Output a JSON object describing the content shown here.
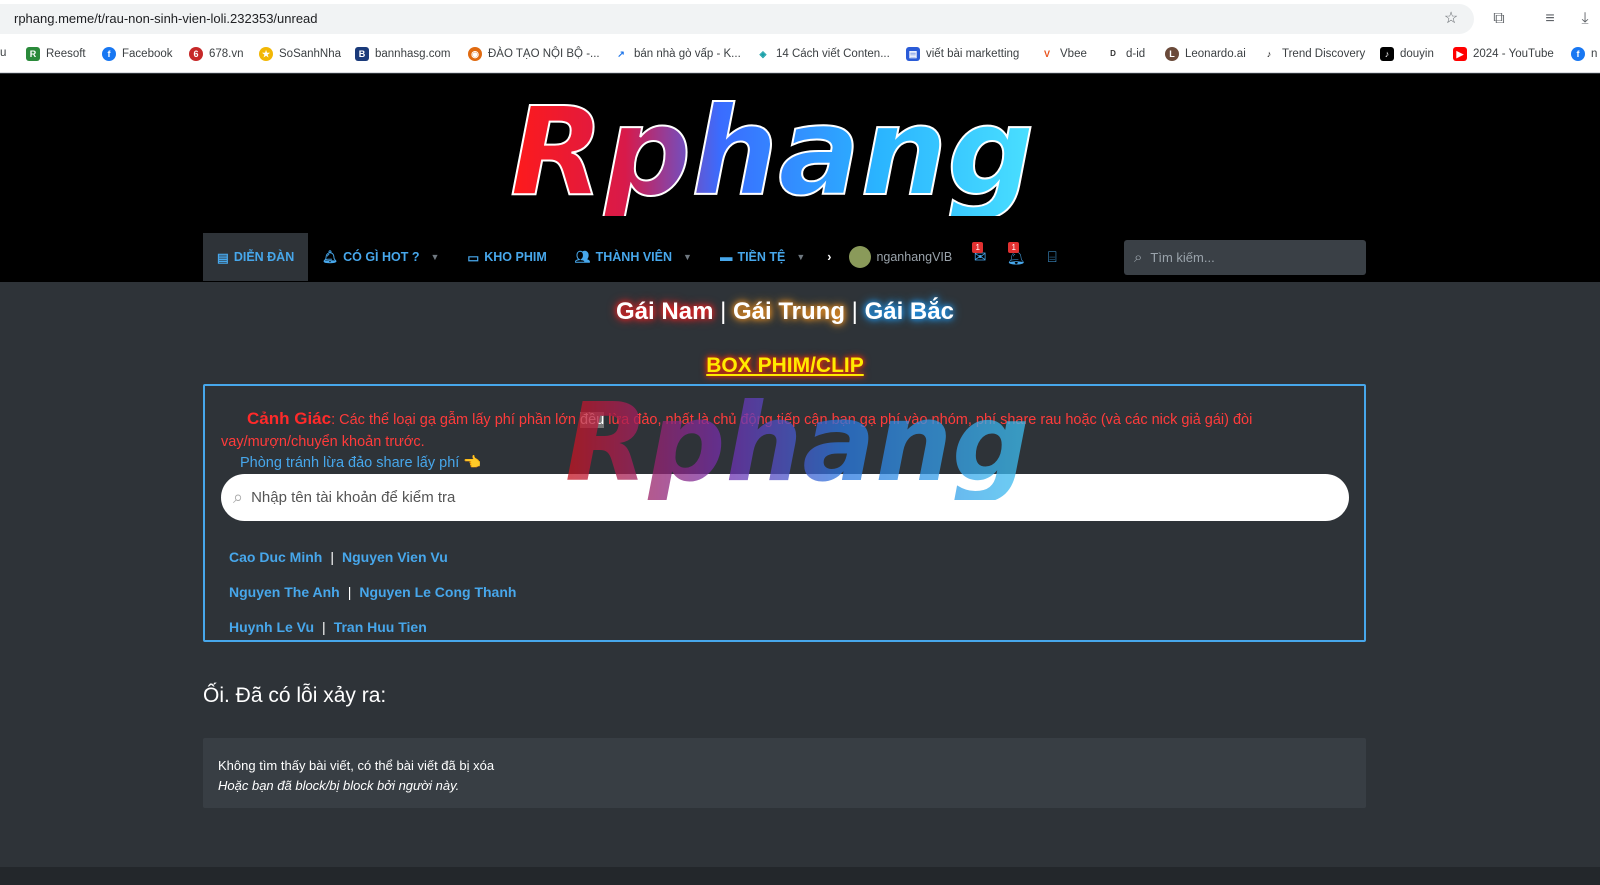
{
  "browser": {
    "url": "rphang.meme/t/rau-non-sinh-vien-loli.232353/unread",
    "bookmarks": [
      {
        "label": "u",
        "icon": "blank-icon"
      },
      {
        "label": "Reesoft",
        "icon": "reesoft-icon"
      },
      {
        "label": "Facebook",
        "icon": "facebook-icon"
      },
      {
        "label": "678.vn",
        "icon": "678-icon"
      },
      {
        "label": "SoSanhNha",
        "icon": "sosanhnha-icon"
      },
      {
        "label": "bannhasg.com",
        "icon": "bannhasg-icon"
      },
      {
        "label": "ĐÀO TẠO NỘI BỘ -...",
        "icon": "daotao-icon"
      },
      {
        "label": "bán nhà gò vấp - K...",
        "icon": "chart-icon"
      },
      {
        "label": "14 Cách viết Conten...",
        "icon": "diamond-icon"
      },
      {
        "label": "viết bài marketting",
        "icon": "docs-icon"
      },
      {
        "label": "Vbee",
        "icon": "vbee-icon"
      },
      {
        "label": "d-id",
        "icon": "did-icon"
      },
      {
        "label": "Leonardo.ai",
        "icon": "leonardo-icon"
      },
      {
        "label": "Trend Discovery",
        "icon": "tiktok-icon"
      },
      {
        "label": "douyin",
        "icon": "douyin-icon"
      },
      {
        "label": "2024 - YouTube",
        "icon": "youtube-icon"
      },
      {
        "label": "n",
        "icon": "facebook-icon"
      }
    ]
  },
  "site": {
    "logo_text": "Rphang",
    "nav": {
      "forum": "DIỄN ĐÀN",
      "hot": "CÓ GÌ HOT ?",
      "movies": "KHO PHIM",
      "members": "THÀNH VIÊN",
      "currency": "TIỀN TỆ",
      "username": "nganhangVIB",
      "inbox_count": "1",
      "alerts_count": "1",
      "search_placeholder": "Tìm kiếm..."
    }
  },
  "regions": {
    "south": "Gái Nam",
    "central": "Gái Trung",
    "north": "Gái Bắc",
    "separator": "|"
  },
  "box_title": "BOX PHIM/CLIP",
  "warning": {
    "heading": "Cảnh Giác",
    "text_before": ": Các thể loại gạ gẫm lấy phí phần lớn ",
    "highlight": "đều",
    "text_after": " lừa đảo, nhất là chủ động tiếp cận bạn gạ phí vào nhóm, phí share rau hoặc (và các nick giả gái) đòi vay/mượn/chuyển khoản trước.",
    "prevent_label": "Phòng tránh lừa đảo share lấy phí 👈",
    "check_placeholder": "Nhập tên tài khoản để kiểm tra",
    "scammers": [
      [
        "Cao Duc Minh",
        "Nguyen Vien Vu"
      ],
      [
        "Nguyen The Anh",
        "Nguyen Le Cong Thanh"
      ],
      [
        "Huynh Le Vu",
        "Tran Huu Tien"
      ]
    ],
    "divider": "|"
  },
  "error": {
    "title": "Ối. Đã có lỗi xảy ra:",
    "line1": "Không tìm thấy bài viết, có thể bài viết đã bị xóa",
    "line2": "Hoặc bạn đã block/bị block bởi người này."
  }
}
